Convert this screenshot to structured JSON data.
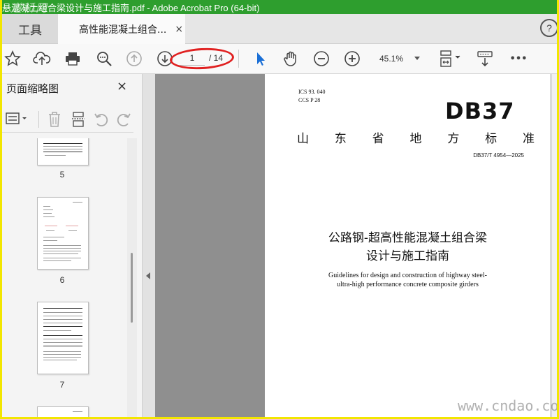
{
  "window": {
    "title": "悬混凝土组合梁设计与施工指南.pdf - Adobe Acrobat Pro (64-bit)",
    "watermark_top": "道桥网"
  },
  "tabs": {
    "tools_label": "工具",
    "doc_label": "高性能混凝土组合...",
    "close": "×",
    "help": "?"
  },
  "toolbar": {
    "current_page": "1",
    "total_pages": "/ 14",
    "zoom": "45.1%",
    "more": "•••"
  },
  "panel": {
    "title": "页面缩略图",
    "close": "×",
    "thumbnails": [
      {
        "label": "5"
      },
      {
        "label": "6"
      },
      {
        "label": "7"
      }
    ]
  },
  "document": {
    "ics": "ICS  93. 040",
    "ccs": "CCS  P  28",
    "standard_mark": "DB37",
    "province_chars": [
      "山",
      "东",
      "省",
      "地",
      "方",
      "标",
      "准"
    ],
    "standard_number": "DB37/T 4954—2025",
    "title_line1": "公路钢-超高性能混凝土组合梁",
    "title_line2": "设计与施工指南",
    "english_line1": "Guidelines for design and construction of highway steel-",
    "english_line2": "ultra-high performance concrete composite girders"
  },
  "watermark_bottom": "www.cndao.com",
  "colors": {
    "titlebar": "#2e9e2e",
    "frame": "#f2e600",
    "annotation": "#e02020",
    "select_tool": "#1a6fd6"
  }
}
